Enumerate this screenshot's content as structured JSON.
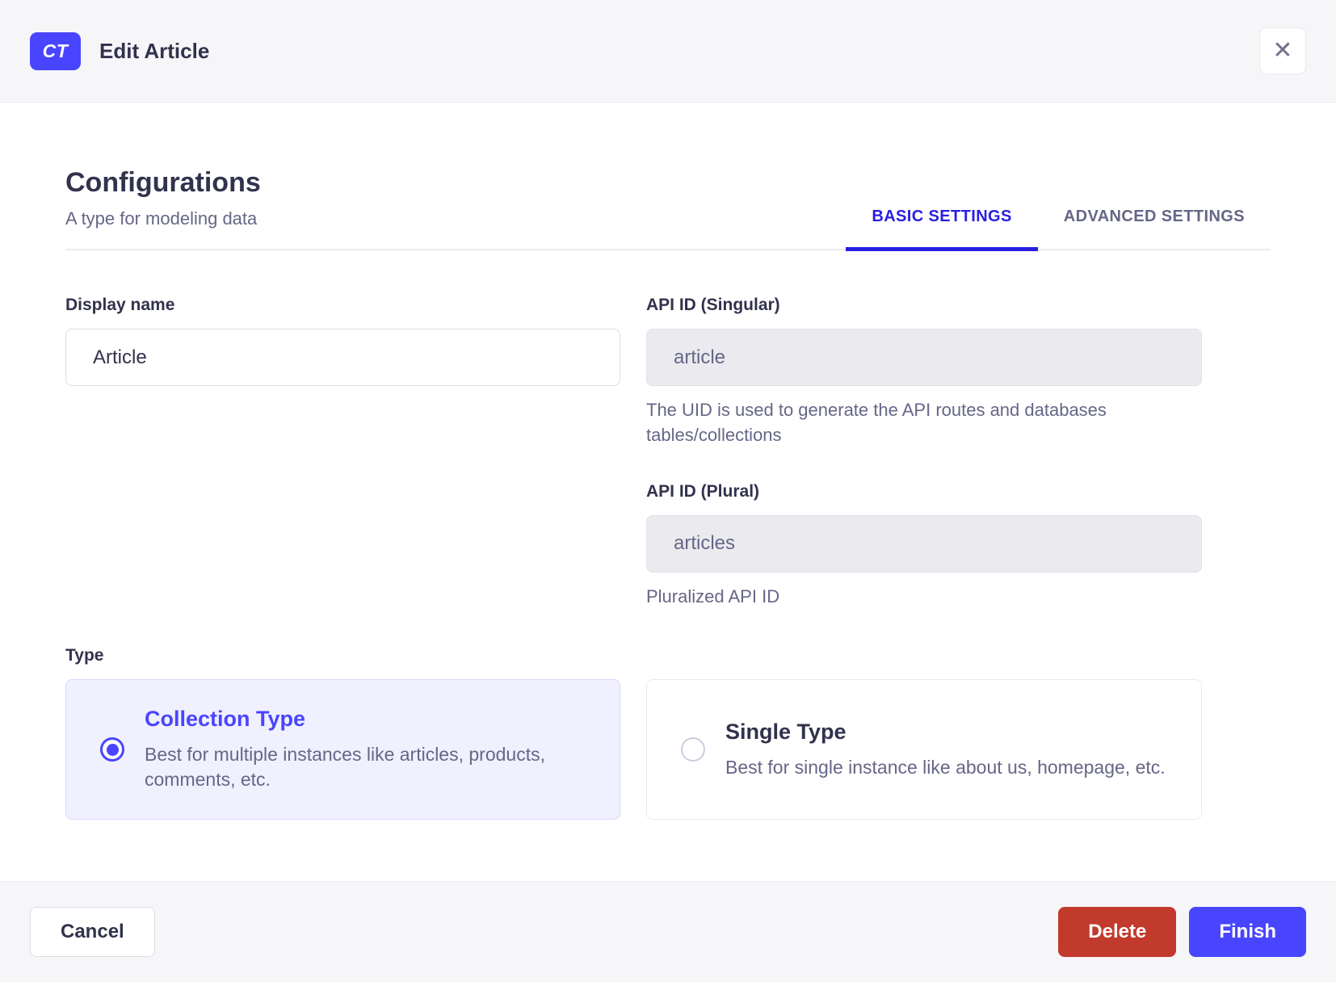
{
  "header": {
    "badge": "CT",
    "title": "Edit Article",
    "close_icon": "✕"
  },
  "section": {
    "title": "Configurations",
    "subtitle": "A type for modeling data"
  },
  "tabs": [
    {
      "label": "BASIC SETTINGS",
      "active": true
    },
    {
      "label": "ADVANCED SETTINGS",
      "active": false
    }
  ],
  "fields": {
    "display_name": {
      "label": "Display name",
      "value": "Article"
    },
    "api_id_singular": {
      "label": "API ID (Singular)",
      "value": "article",
      "hint": "The UID is used to generate the API routes and databases tables/collections",
      "disabled": true
    },
    "api_id_plural": {
      "label": "API ID (Plural)",
      "value": "articles",
      "hint": "Pluralized API ID",
      "disabled": true
    }
  },
  "type": {
    "label": "Type",
    "options": [
      {
        "title": "Collection Type",
        "description": "Best for multiple instances like articles, products, comments, etc.",
        "selected": true
      },
      {
        "title": "Single Type",
        "description": "Best for single instance like about us, homepage, etc.",
        "selected": false
      }
    ]
  },
  "footer": {
    "cancel_label": "Cancel",
    "delete_label": "Delete",
    "finish_label": "Finish"
  },
  "colors": {
    "primary": "#4945ff",
    "tab_active": "#271fe0",
    "danger": "#c23a2c",
    "heading_text": "#32324d",
    "muted_text": "#666687",
    "surface_gray": "#f6f6f9",
    "selected_card_bg": "#f0f0ff",
    "disabled_input_bg": "#eaeaef",
    "border": "#dcdce4"
  }
}
